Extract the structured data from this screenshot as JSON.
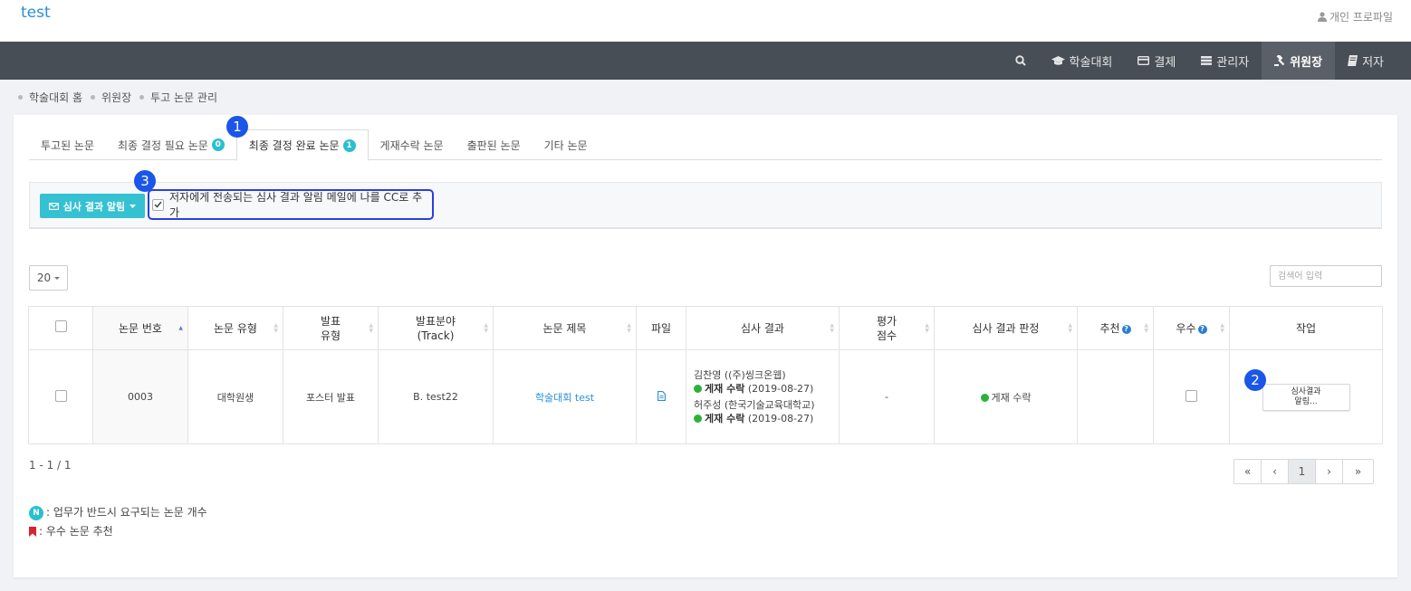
{
  "header": {
    "site_title": "test",
    "profile_label": "개인 프로파일"
  },
  "nav": [
    {
      "label": "",
      "icon": "search-icon"
    },
    {
      "label": "학술대회",
      "icon": "graduation-cap-icon"
    },
    {
      "label": "결제",
      "icon": "credit-card-icon"
    },
    {
      "label": "관리자",
      "icon": "server-icon"
    },
    {
      "label": "위원장",
      "icon": "gavel-icon",
      "active": true
    },
    {
      "label": "저자",
      "icon": "book-icon"
    }
  ],
  "breadcrumb": [
    "학술대회 홈",
    "위원장",
    "투고 논문 관리"
  ],
  "tabs": [
    {
      "label": "투고된 논문"
    },
    {
      "label": "최종 결정 필요 논문",
      "badge": "0"
    },
    {
      "label": "최종 결정 완료 논문",
      "badge": "1",
      "active": true
    },
    {
      "label": "게재수락 논문"
    },
    {
      "label": "출판된 논문"
    },
    {
      "label": "기타 논문"
    }
  ],
  "markers": [
    "1",
    "2",
    "3"
  ],
  "actions": {
    "notify_button": "심사 결과 알림",
    "cc_label": "저자에게 전송되는 심사 결과 알림 메일에 나를 CC로 추가",
    "cc_checked": true
  },
  "page_size": "20",
  "search": {
    "placeholder": "검색어 입력"
  },
  "table": {
    "headers": {
      "paper_no": "논문 번호",
      "paper_type": "논문 유형",
      "presentation_type": [
        "발표",
        "유형"
      ],
      "track": [
        "발표분야",
        "(Track)"
      ],
      "title": "논문 제목",
      "file": "파일",
      "review_result": "심사 결과",
      "score": [
        "평가",
        "점수"
      ],
      "decision": "심사 결과 판정",
      "recommend": "추천",
      "excellent": "우수",
      "task": "작업"
    },
    "rows": [
      {
        "paper_no": "0003",
        "paper_type": "대학원생",
        "presentation_type": "포스터 발표",
        "track": "B. test22",
        "title": "학술대회 test",
        "reviews": [
          {
            "reviewer": "김찬영 ((주)씽크온웹)",
            "status": "게재 수락",
            "date": "(2019-08-27)"
          },
          {
            "reviewer": "허주성 (한국기술교육대학교)",
            "status": "게재 수락",
            "date": "(2019-08-27)"
          }
        ],
        "score": "-",
        "decision": "게재 수락",
        "task_button": [
          "심사결과",
          "알림..."
        ]
      }
    ]
  },
  "pagination": {
    "summary": "1 - 1 / 1",
    "first": "«",
    "prev": "‹",
    "current": "1",
    "next": "›",
    "last": "»"
  },
  "legend": {
    "n_badge": "N",
    "n_text": ": 업무가 반드시 요구되는 논문 개수",
    "bookmark_text": ": 우수 논문 추천"
  },
  "colors": {
    "accent": "#34c1d1",
    "nav_bg": "#484e55",
    "link": "#2a8fd6",
    "marker": "#1a56e8",
    "accept": "#2cb23a",
    "bookmark": "#d9232d"
  }
}
